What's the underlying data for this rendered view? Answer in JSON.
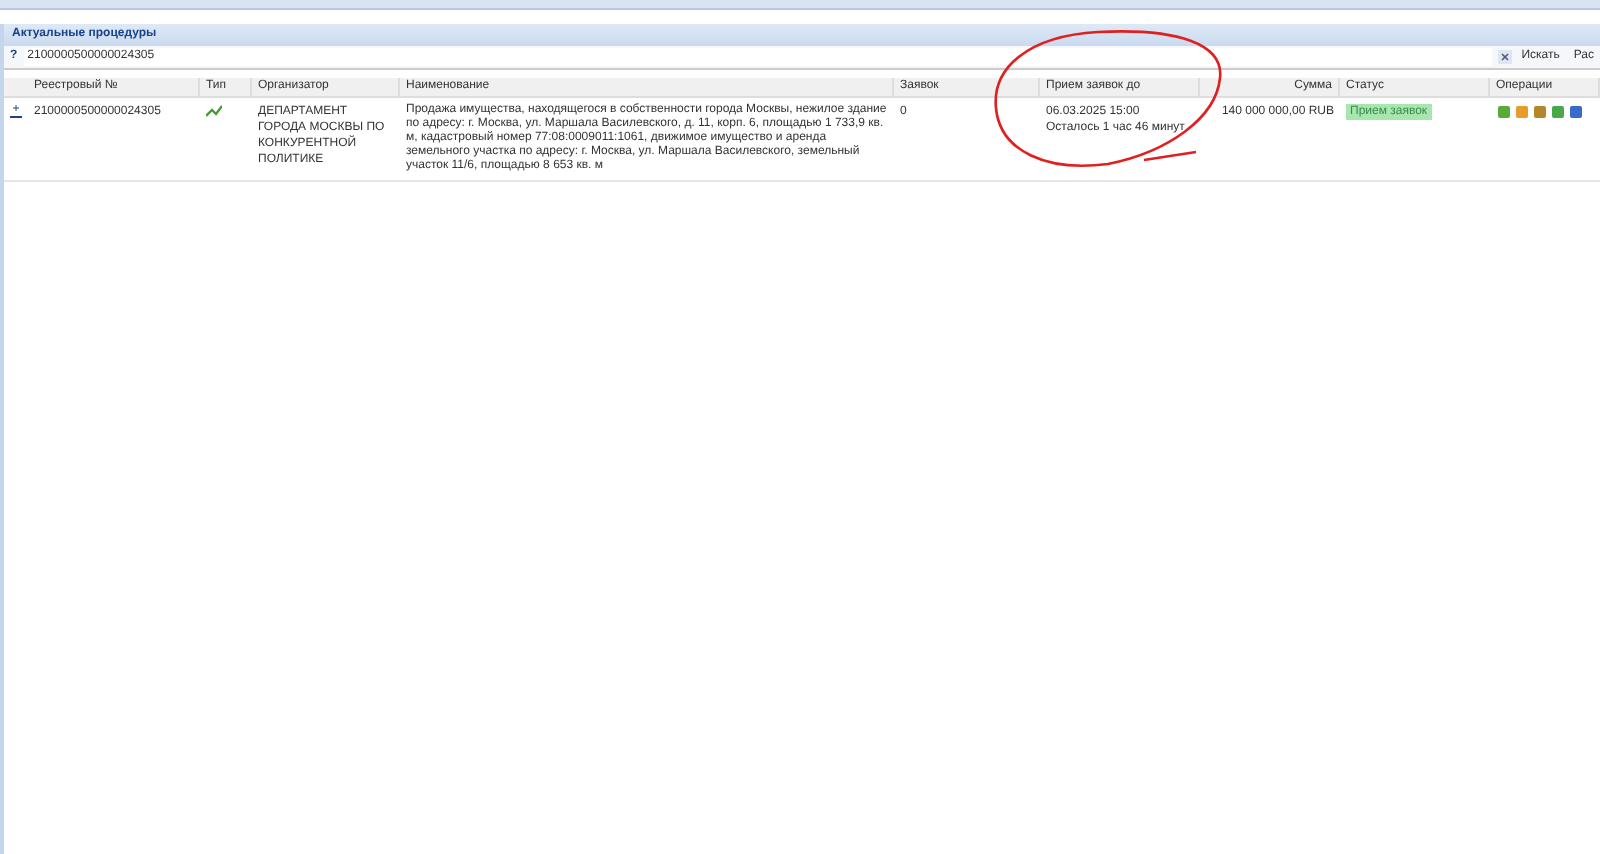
{
  "panel": {
    "title": "Актуальные процедуры"
  },
  "search": {
    "prefix": "?",
    "value": "2100000500000024305",
    "search_button": "Искать",
    "second_button": "Рас"
  },
  "table": {
    "columns": [
      "Реестровый №",
      "Тип",
      "Организатор",
      "Наименование",
      "Заявок",
      "Прием заявок до",
      "Сумма",
      "Статус",
      "Операции"
    ],
    "rows": [
      {
        "expander": "+",
        "registry": "2100000500000024305",
        "organizer": "ДЕПАРТАМЕНТ ГОРОДА МОСКВЫ ПО КОНКУРЕНТНОЙ ПОЛИТИКЕ",
        "name": "Продажа имущества, находящегося в собственности города Москвы, нежилое здание по адресу: г. Москва, ул. Маршала Василевского, д. 11, корп. 6, площадью 1 733,9 кв. м, кадастровый номер 77:08:0009011:1061, движимое имущество и аренда земельного участка по адресу: г. Москва, ул. Маршала Василевского, земельный участок 11/6, площадью 8 653 кв. м",
        "bids": "0",
        "deadline": "06.03.2025 15:00",
        "remaining": "Осталось 1 час 46 минут",
        "sum": "140 000 000,00 RUB",
        "status": "Прием заявок"
      }
    ]
  }
}
